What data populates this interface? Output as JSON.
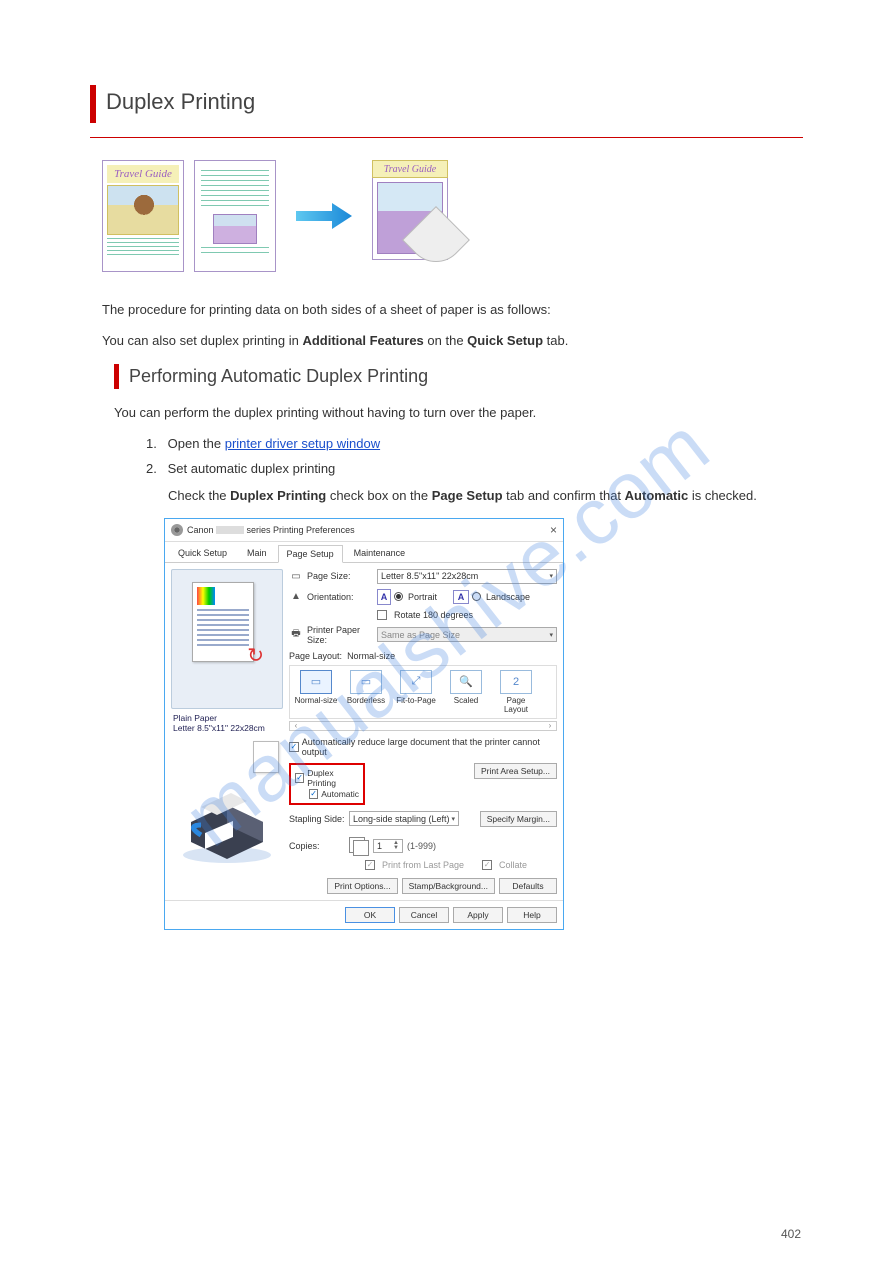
{
  "section_title": "Duplex Printing",
  "illus": {
    "travel_title": "Travel Guide"
  },
  "intro_text": "The procedure for printing data on both sides of a sheet of paper is as follows:",
  "quick_note_prefix": "You can also set duplex printing in ",
  "quick_note_bold": "Additional Features",
  "quick_note_suffix": " on the ",
  "quick_note_bold2": "Quick Setup",
  "quick_note_suffix2": " tab.",
  "subsection_title": "Performing Automatic Duplex Printing",
  "auto_intro": "You can perform the duplex printing without having to turn over the paper.",
  "steps": {
    "s1_num": "1.",
    "s1_text_prefix": "Open the ",
    "s1_link": "printer driver setup window",
    "s2_num": "2.",
    "s2_text": "Set automatic duplex printing",
    "s2_detail_prefix": "Check the ",
    "s2_detail_b1": "Duplex Printing",
    "s2_detail_mid": " check box on the ",
    "s2_detail_b2": "Page Setup",
    "s2_detail_mid2": " tab and confirm that ",
    "s2_detail_b3": "Automatic",
    "s2_detail_end": " is checked."
  },
  "dialog": {
    "title_prefix": "Canon ",
    "title_suffix": " series Printing Preferences",
    "close": "×",
    "tabs": {
      "quick": "Quick Setup",
      "main": "Main",
      "page": "Page Setup",
      "maint": "Maintenance"
    },
    "preview_media": "Plain Paper",
    "preview_size": "Letter 8.5\"x11\" 22x28cm",
    "page_size_lbl": "Page Size:",
    "page_size_val": "Letter 8.5\"x11\" 22x28cm",
    "orientation_lbl": "Orientation:",
    "portrait": "Portrait",
    "landscape": "Landscape",
    "rotate180": "Rotate 180 degrees",
    "printer_paper_lbl": "Printer Paper Size:",
    "printer_paper_val": "Same as Page Size",
    "page_layout_lbl": "Page Layout:",
    "page_layout_val": "Normal-size",
    "layouts": {
      "normal": "Normal-size",
      "borderless": "Borderless",
      "fit": "Fit-to-Page",
      "scaled": "Scaled",
      "pagelayout": "Page Layout"
    },
    "auto_reduce": "Automatically reduce large document that the printer cannot output",
    "duplex_printing": "Duplex Printing",
    "automatic": "Automatic",
    "print_area_setup": "Print Area Setup...",
    "stapling_lbl": "Stapling Side:",
    "stapling_val": "Long-side stapling (Left)",
    "specify_margin": "Specify Margin...",
    "copies_lbl": "Copies:",
    "copies_val": "1",
    "copies_range": "(1-999)",
    "print_last": "Print from Last Page",
    "collate": "Collate",
    "print_options": "Print Options...",
    "stamp_bg": "Stamp/Background...",
    "defaults": "Defaults",
    "ok": "OK",
    "cancel": "Cancel",
    "apply": "Apply",
    "help": "Help"
  },
  "watermark": "manualshive.com",
  "page_number": "402"
}
